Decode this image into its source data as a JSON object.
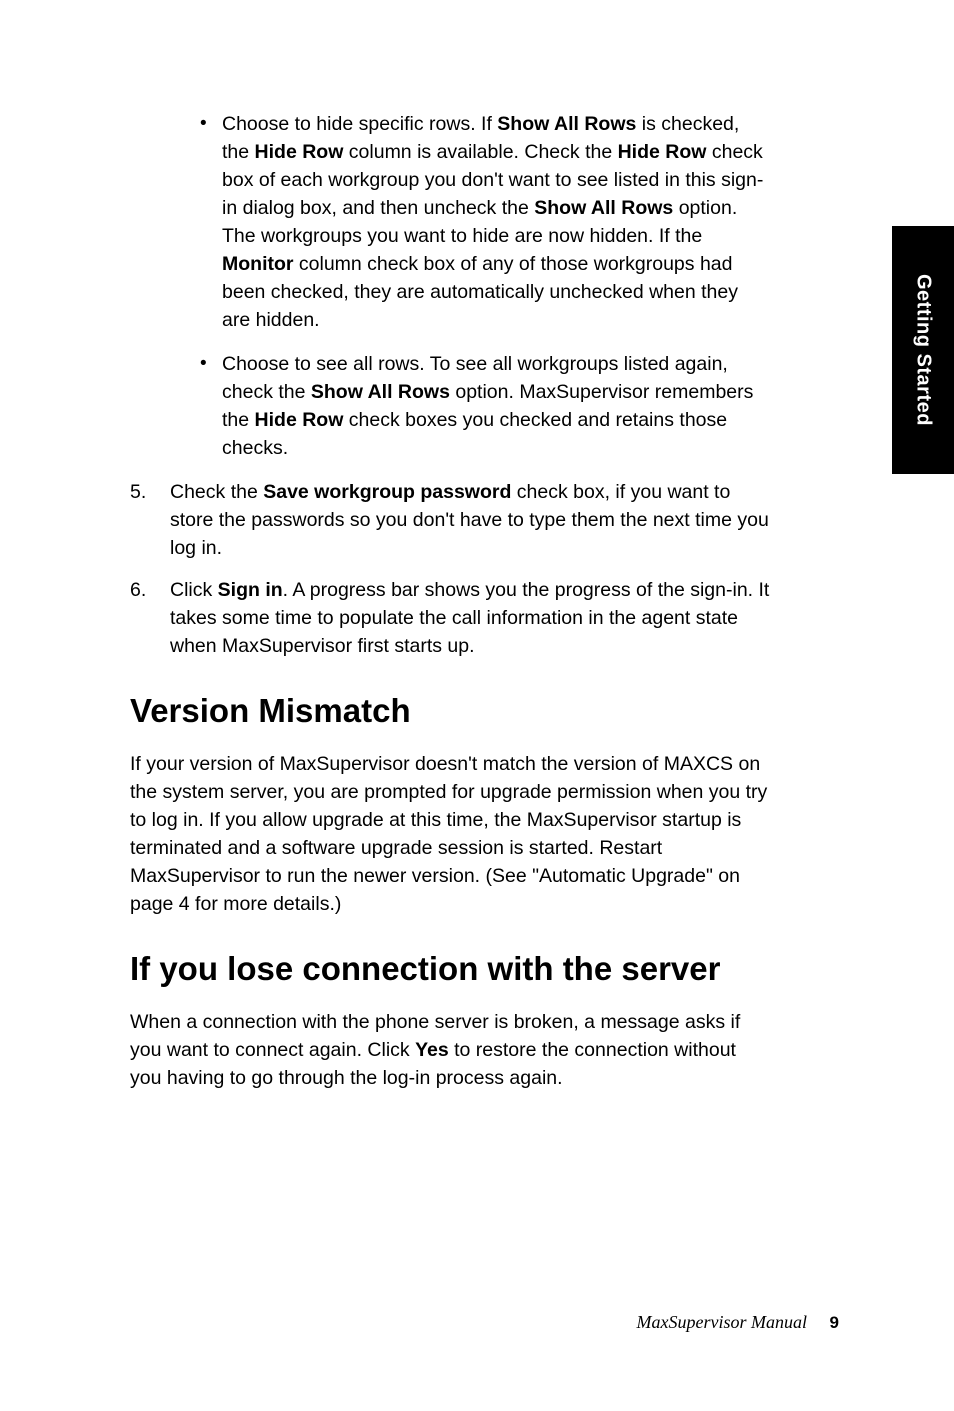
{
  "sideTab": "Getting Started",
  "bullets": {
    "b1_pre": "Choose to hide specific rows. If ",
    "b1_bold1": "Show All Rows",
    "b1_mid1": " is checked, the ",
    "b1_bold2": "Hide Row",
    "b1_mid2": " column is available. Check the ",
    "b1_bold3": "Hide Row",
    "b1_mid3": " check box of each workgroup you don't want to see listed in this sign-in dialog box, and then uncheck the ",
    "b1_bold4": "Show All Rows",
    "b1_mid4": " option. The workgroups you want to hide are now hidden. If the ",
    "b1_bold5": "Monitor",
    "b1_post": " column check box of any of those workgroups had been checked, they are automatically unchecked when they are hidden.",
    "b2_pre": "Choose to see all rows. To see all workgroups listed again, check the ",
    "b2_bold1": "Show All Rows",
    "b2_mid1": " option. MaxSupervisor remembers the ",
    "b2_bold2": "Hide Row",
    "b2_post": " check boxes you checked and retains those checks."
  },
  "steps": {
    "s5_num": "5.",
    "s5_pre": "Check the ",
    "s5_bold": "Save workgroup password",
    "s5_post": " check box, if you want to store the passwords so you don't have to type them the next time you log in.",
    "s6_num": "6.",
    "s6_pre": "Click ",
    "s6_bold": "Sign in",
    "s6_post": ". A progress bar shows you the progress of the sign-in. It takes some time to populate the call information in the agent state when MaxSupervisor first starts up."
  },
  "section1": {
    "heading": "Version Mismatch",
    "para": "If your version of MaxSupervisor doesn't match the version of MAXCS on the system server, you are prompted for upgrade permission when you try to log in. If you allow upgrade at this time, the MaxSupervisor startup is terminated and a software upgrade session is started. Restart MaxSupervisor to run the newer version. (See \"Automatic Upgrade\" on page 4 for more details.)"
  },
  "section2": {
    "heading": "If you lose connection with the server",
    "p_pre": "When a connection with the phone server is broken, a message asks if you want to connect again. Click ",
    "p_bold": "Yes",
    "p_post": " to restore the connection without you having to go through the log-in process again."
  },
  "footer": {
    "title": "MaxSupervisor Manual",
    "page": "9"
  }
}
